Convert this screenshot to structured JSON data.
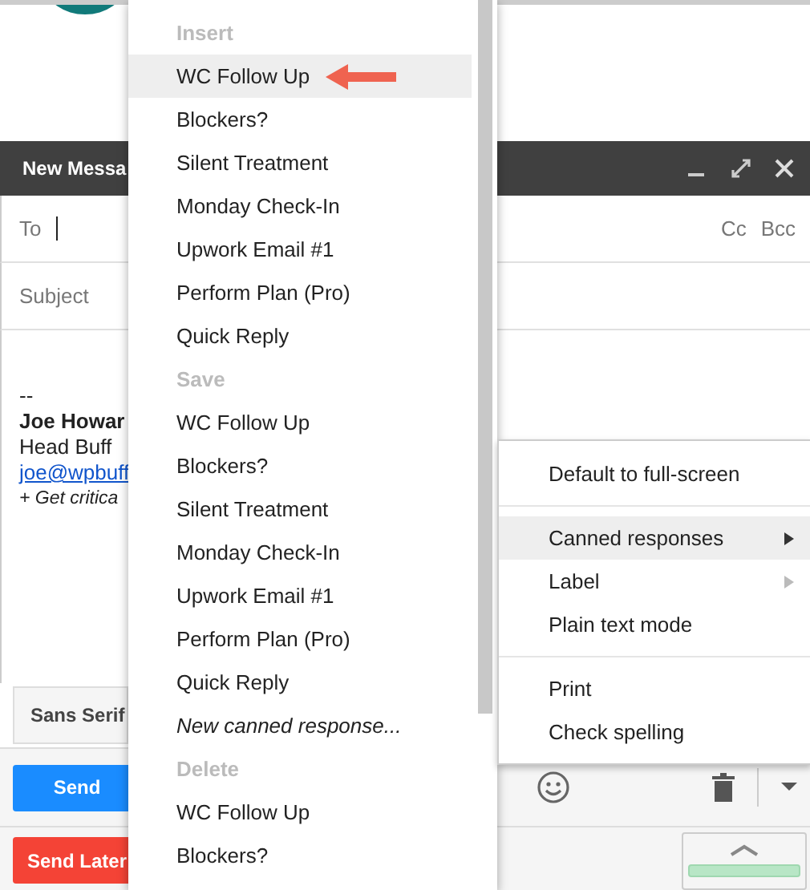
{
  "compose": {
    "title": "New Messa",
    "to_label": "To",
    "cc": "Cc",
    "bcc": "Bcc",
    "subject_placeholder": "Subject",
    "signature": {
      "separator": "--",
      "name": "Joe Howar",
      "role": "Head Buff",
      "email": "joe@wpbuff",
      "tagline": "+ Get critica"
    },
    "font": "Sans Serif",
    "send": "Send",
    "send_later": "Send Later"
  },
  "canned_menu": {
    "sections": [
      {
        "heading": "Insert",
        "items": [
          {
            "kind": "response",
            "label": "WC Follow Up",
            "selected": true,
            "marked": true
          },
          {
            "kind": "response",
            "label": "Blockers?",
            "selected": false
          },
          {
            "kind": "response",
            "label": "Silent Treatment",
            "selected": false
          },
          {
            "kind": "response",
            "label": "Monday Check-In",
            "selected": false
          },
          {
            "kind": "response",
            "label": "Upwork Email #1",
            "selected": false
          },
          {
            "kind": "response",
            "label": "Perform Plan (Pro)",
            "selected": false
          },
          {
            "kind": "response",
            "label": "Quick Reply",
            "selected": false
          }
        ]
      },
      {
        "heading": "Save",
        "items": [
          {
            "kind": "response",
            "label": "WC Follow Up",
            "selected": false
          },
          {
            "kind": "response",
            "label": "Blockers?",
            "selected": false
          },
          {
            "kind": "response",
            "label": "Silent Treatment",
            "selected": false
          },
          {
            "kind": "response",
            "label": "Monday Check-In",
            "selected": false
          },
          {
            "kind": "response",
            "label": "Upwork Email #1",
            "selected": false
          },
          {
            "kind": "response",
            "label": "Perform Plan (Pro)",
            "selected": false
          },
          {
            "kind": "response",
            "label": "Quick Reply",
            "selected": false
          },
          {
            "kind": "new",
            "label": "New canned response...",
            "selected": false
          }
        ]
      },
      {
        "heading": "Delete",
        "items": [
          {
            "kind": "response",
            "label": "WC Follow Up",
            "selected": false
          },
          {
            "kind": "response",
            "label": "Blockers?",
            "selected": false
          }
        ]
      }
    ]
  },
  "more_menu": {
    "groups": [
      [
        {
          "label": "Default to full-screen",
          "selected": false
        }
      ],
      [
        {
          "label": "Canned responses",
          "selected": true,
          "submenu": true,
          "submenu_enabled": true
        },
        {
          "label": "Label",
          "selected": false,
          "submenu": true,
          "submenu_enabled": false
        },
        {
          "label": "Plain text mode",
          "selected": false
        }
      ],
      [
        {
          "label": "Print",
          "selected": false
        },
        {
          "label": "Check spelling",
          "selected": false
        }
      ]
    ]
  }
}
